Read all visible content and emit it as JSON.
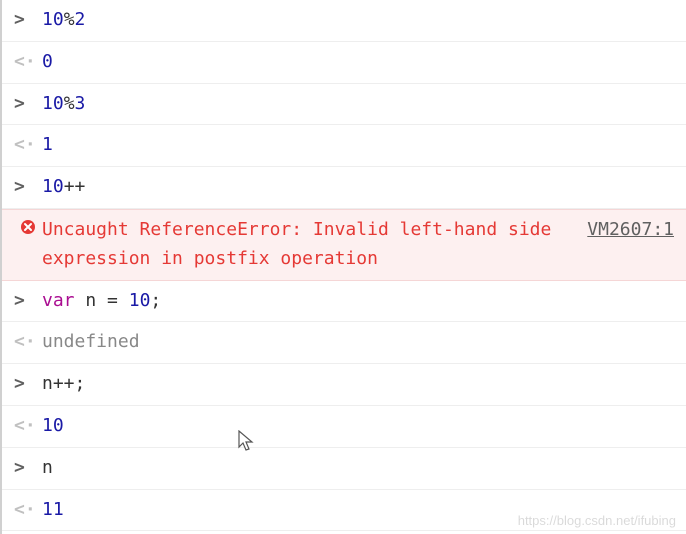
{
  "entries": [
    {
      "kind": "input",
      "tokens": [
        {
          "t": "num",
          "v": "10"
        },
        {
          "t": "op",
          "v": "%"
        },
        {
          "t": "num",
          "v": "2"
        }
      ]
    },
    {
      "kind": "output",
      "tokens": [
        {
          "t": "num",
          "v": "0"
        }
      ]
    },
    {
      "kind": "input",
      "tokens": [
        {
          "t": "num",
          "v": "10"
        },
        {
          "t": "op",
          "v": "%"
        },
        {
          "t": "num",
          "v": "3"
        }
      ]
    },
    {
      "kind": "output",
      "tokens": [
        {
          "t": "num",
          "v": "1"
        }
      ]
    },
    {
      "kind": "input",
      "tokens": [
        {
          "t": "num",
          "v": "10"
        },
        {
          "t": "op",
          "v": "++"
        }
      ]
    },
    {
      "kind": "error",
      "message": "Uncaught ReferenceError: Invalid left-hand side expression in postfix operation",
      "source": "VM2607:1"
    },
    {
      "kind": "input",
      "tokens": [
        {
          "t": "kw",
          "v": "var"
        },
        {
          "t": "sp",
          "v": " "
        },
        {
          "t": "ident",
          "v": "n"
        },
        {
          "t": "sp",
          "v": " "
        },
        {
          "t": "op",
          "v": "="
        },
        {
          "t": "sp",
          "v": " "
        },
        {
          "t": "num",
          "v": "10"
        },
        {
          "t": "op",
          "v": ";"
        }
      ]
    },
    {
      "kind": "output",
      "tokens": [
        {
          "t": "undef",
          "v": "undefined"
        }
      ]
    },
    {
      "kind": "input",
      "tokens": [
        {
          "t": "ident",
          "v": "n"
        },
        {
          "t": "op",
          "v": "++"
        },
        {
          "t": "op",
          "v": ";"
        }
      ]
    },
    {
      "kind": "output",
      "tokens": [
        {
          "t": "num",
          "v": "10"
        }
      ]
    },
    {
      "kind": "input",
      "tokens": [
        {
          "t": "ident",
          "v": "n"
        }
      ]
    },
    {
      "kind": "output",
      "tokens": [
        {
          "t": "num",
          "v": "11"
        }
      ]
    }
  ],
  "prompts": {
    "input": ">",
    "output": "<·"
  },
  "watermark": "https://blog.csdn.net/ifubing"
}
